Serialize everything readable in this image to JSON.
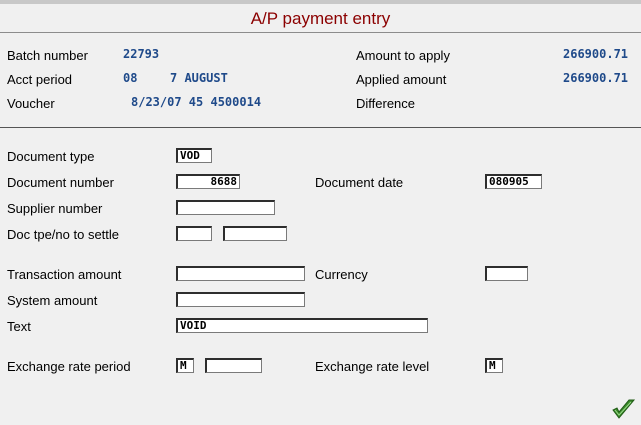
{
  "title": "A/P payment entry",
  "header": {
    "batch_number_label": "Batch number",
    "batch_number": "22793",
    "acct_period_label": "Acct period",
    "acct_period_num": "08",
    "acct_period_name": "7 AUGUST",
    "voucher_label": "Voucher",
    "voucher": "8/23/07 45 4500014",
    "amount_to_apply_label": "Amount to apply",
    "amount_to_apply": "266900.71",
    "applied_amount_label": "Applied amount",
    "applied_amount": "266900.71",
    "difference_label": "Difference",
    "difference": ""
  },
  "form": {
    "document_type_label": "Document type",
    "document_type": "VOD",
    "document_number_label": "Document number",
    "document_number": "8688",
    "document_date_label": "Document date",
    "document_date": "080905",
    "supplier_number_label": "Supplier number",
    "supplier_number": "",
    "doc_settle_label": "Doc tpe/no to settle",
    "doc_settle_type": "",
    "doc_settle_number": "",
    "transaction_amount_label": "Transaction amount",
    "transaction_amount": "",
    "currency_label": "Currency",
    "currency": "",
    "system_amount_label": "System amount",
    "system_amount": "",
    "text_label": "Text",
    "text": "VOID",
    "exchange_rate_period_label": "Exchange rate period",
    "exchange_rate_period_code": "M",
    "exchange_rate_period_value": "",
    "exchange_rate_level_label": "Exchange rate level",
    "exchange_rate_level": "M"
  },
  "icons": {
    "confirm": "checkmark-icon",
    "confirm_color": "#3a8a2a"
  }
}
